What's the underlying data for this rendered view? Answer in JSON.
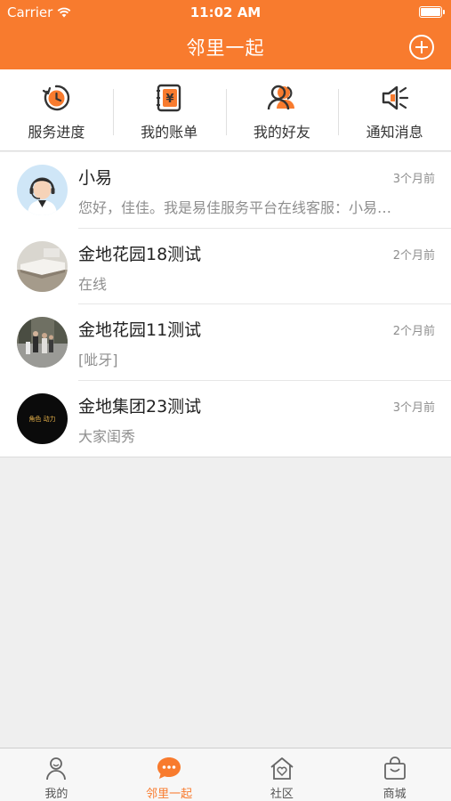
{
  "status_bar": {
    "carrier": "Carrier",
    "time": "11:02 AM"
  },
  "nav": {
    "title": "邻里一起",
    "add_icon": "plus-circle-icon"
  },
  "quick_actions": [
    {
      "label": "服务进度",
      "icon": "clock-progress-icon"
    },
    {
      "label": "我的账单",
      "icon": "bill-yen-icon"
    },
    {
      "label": "我的好友",
      "icon": "friends-icon"
    },
    {
      "label": "通知消息",
      "icon": "megaphone-icon"
    }
  ],
  "conversations": [
    {
      "name": "小易",
      "time": "3个月前",
      "message": "您好，佳佳。我是易佳服务平台在线客服：小易…",
      "avatar": "customer-service-avatar"
    },
    {
      "name": "金地花园18测试",
      "time": "2个月前",
      "message": "在线",
      "avatar": "photo-avatar"
    },
    {
      "name": "金地花园11测试",
      "time": "2个月前",
      "message": "[呲牙]",
      "avatar": "photo-avatar"
    },
    {
      "name": "金地集团23测试",
      "time": "3个月前",
      "message": "大家闺秀",
      "avatar": "logo-avatar",
      "avatar_text": "角色 动力"
    }
  ],
  "tabs": [
    {
      "label": "我的",
      "icon": "person-icon",
      "active": false
    },
    {
      "label": "邻里一起",
      "icon": "chat-bubble-icon",
      "active": true
    },
    {
      "label": "社区",
      "icon": "house-heart-icon",
      "active": false
    },
    {
      "label": "商城",
      "icon": "shopping-bag-icon",
      "active": false
    }
  ],
  "colors": {
    "accent": "#f87b2e",
    "background": "#efefef",
    "text": "#222222",
    "muted": "#8e8e8e"
  }
}
